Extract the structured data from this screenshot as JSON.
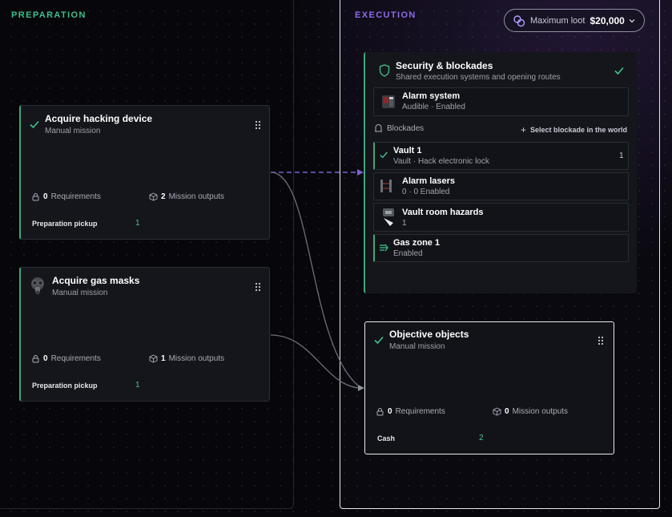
{
  "preparation": {
    "title": "PREPARATION",
    "cards": [
      {
        "title": "Acquire hacking device",
        "subtitle": "Manual mission",
        "requirements_count": "0",
        "requirements_label": "Requirements",
        "outputs_count": "2",
        "outputs_label": "Mission outputs",
        "pickup_label": "Preparation pickup",
        "pickup_count": "1",
        "icon": "check-icon"
      },
      {
        "title": "Acquire gas masks",
        "subtitle": "Manual mission",
        "requirements_count": "0",
        "requirements_label": "Requirements",
        "outputs_count": "1",
        "outputs_label": "Mission outputs",
        "pickup_label": "Preparation pickup",
        "pickup_count": "1",
        "icon": "gas-mask-icon"
      }
    ]
  },
  "execution": {
    "title": "EXECUTION",
    "loot": {
      "label": "Maximum loot",
      "value": "$20,000"
    },
    "security": {
      "title": "Security & blockades",
      "subtitle": "Shared execution systems and opening routes",
      "alarm": {
        "title": "Alarm system",
        "subtitle": "Audible · Enabled"
      },
      "blockades_label": "Blockades",
      "blockades_action": "Select blockade in the world",
      "items": [
        {
          "title": "Vault 1",
          "subtitle": "Vault · Hack electronic lock",
          "count": "1",
          "icon": "check-icon"
        },
        {
          "title": "Alarm lasers",
          "subtitle": "0 · 0 Enabled",
          "icon": "laser-icon"
        },
        {
          "title": "Vault room hazards",
          "subtitle": "1",
          "icon": "hazard-icon"
        },
        {
          "title": "Gas zone 1",
          "subtitle": "Enabled",
          "icon": "gas-zone-icon"
        }
      ]
    },
    "objective": {
      "title": "Objective objects",
      "subtitle": "Manual mission",
      "requirements_count": "0",
      "requirements_label": "Requirements",
      "outputs_count": "0",
      "outputs_label": "Mission outputs",
      "pickup_label": "Cash",
      "pickup_count": "2"
    }
  },
  "colors": {
    "accent_green": "#3fa877",
    "accent_purple": "#8f6be8",
    "dashed_link": "#7b62d6",
    "wire": "#6b7078"
  }
}
